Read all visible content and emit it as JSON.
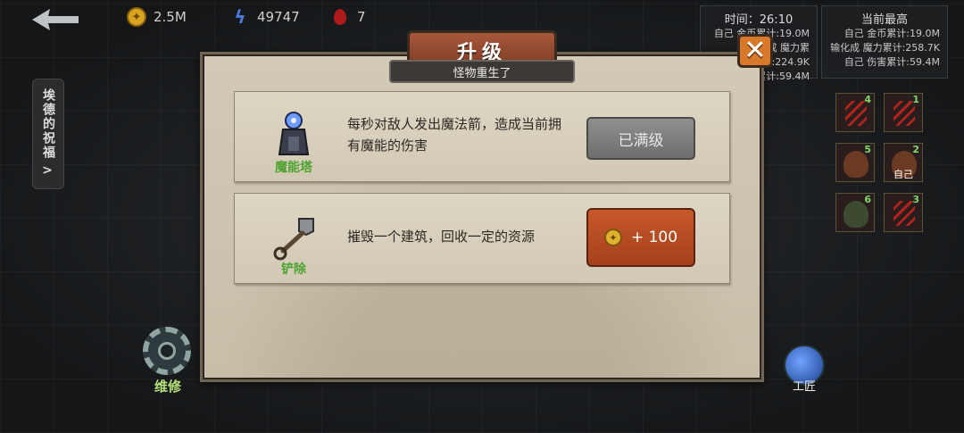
{
  "hud": {
    "gold": "2.5M",
    "energy": "49747",
    "blood": "7",
    "gold_icon": "coin-icon",
    "energy_icon": "lightning-icon",
    "blood_icon": "blood-drop-icon"
  },
  "stats": {
    "timer_label": "时间：26:10",
    "timer_lines": [
      "自己 金币累计:19.0M",
      "输化成 魔力累计:224.9K",
      "自己 伤害累计:59.4M"
    ],
    "best_title": "当前最高",
    "best_lines": [
      "自己 金币累计:19.0M",
      "输化成 魔力累计:258.7K",
      "自己 伤害累计:59.4M"
    ]
  },
  "left_tab": {
    "label": "埃德的祝福",
    "chevron": ">"
  },
  "repair": {
    "label": "维修"
  },
  "crafter": {
    "label": "工匠"
  },
  "heroes": [
    {
      "num": "4",
      "type": "slash"
    },
    {
      "num": "1",
      "type": "slash"
    },
    {
      "num": "5",
      "type": "face"
    },
    {
      "num": "2",
      "type": "face",
      "label": "自己"
    },
    {
      "num": "6",
      "type": "face"
    },
    {
      "num": "3",
      "type": "slash"
    }
  ],
  "dialog": {
    "title": "升级",
    "subtitle": "怪物重生了",
    "close": "✕",
    "options": [
      {
        "name": "魔能塔",
        "description": "每秒对敌人发出魔法箭，造成当前拥有魔能的伤害",
        "button": "已满级",
        "icon": "magic-tower-icon"
      },
      {
        "name": "铲除",
        "description": "摧毁一个建筑，回收一定的资源",
        "button": "+ 100",
        "icon": "shovel-icon"
      }
    ]
  },
  "colors": {
    "accent_orange": "#c7582a",
    "option_name_green": "#4ea332",
    "title_plate": "#8a4530"
  }
}
